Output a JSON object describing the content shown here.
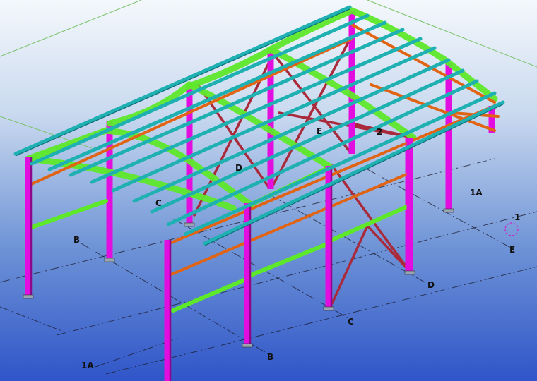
{
  "grid_labels": {
    "front_1A": "1A",
    "front_B": "B",
    "front_C": "C",
    "front_D": "D",
    "front_E": "E",
    "side_1A": "1A",
    "side_1": "1",
    "left_B": "B",
    "roof_C": "C",
    "roof_D": "D",
    "roof_E": "E",
    "roof_2": "2"
  },
  "colors": {
    "columns": "#e20ee0",
    "rafters": "#5ee82a",
    "purlins": "#1fb0b2",
    "eave_rails": "#e06414",
    "bracing": "#a92a3b",
    "background_top": "#f4f8fc",
    "background_bottom": "#2f55c9"
  },
  "icons": {
    "work_point": "dashed-circle-marker"
  }
}
